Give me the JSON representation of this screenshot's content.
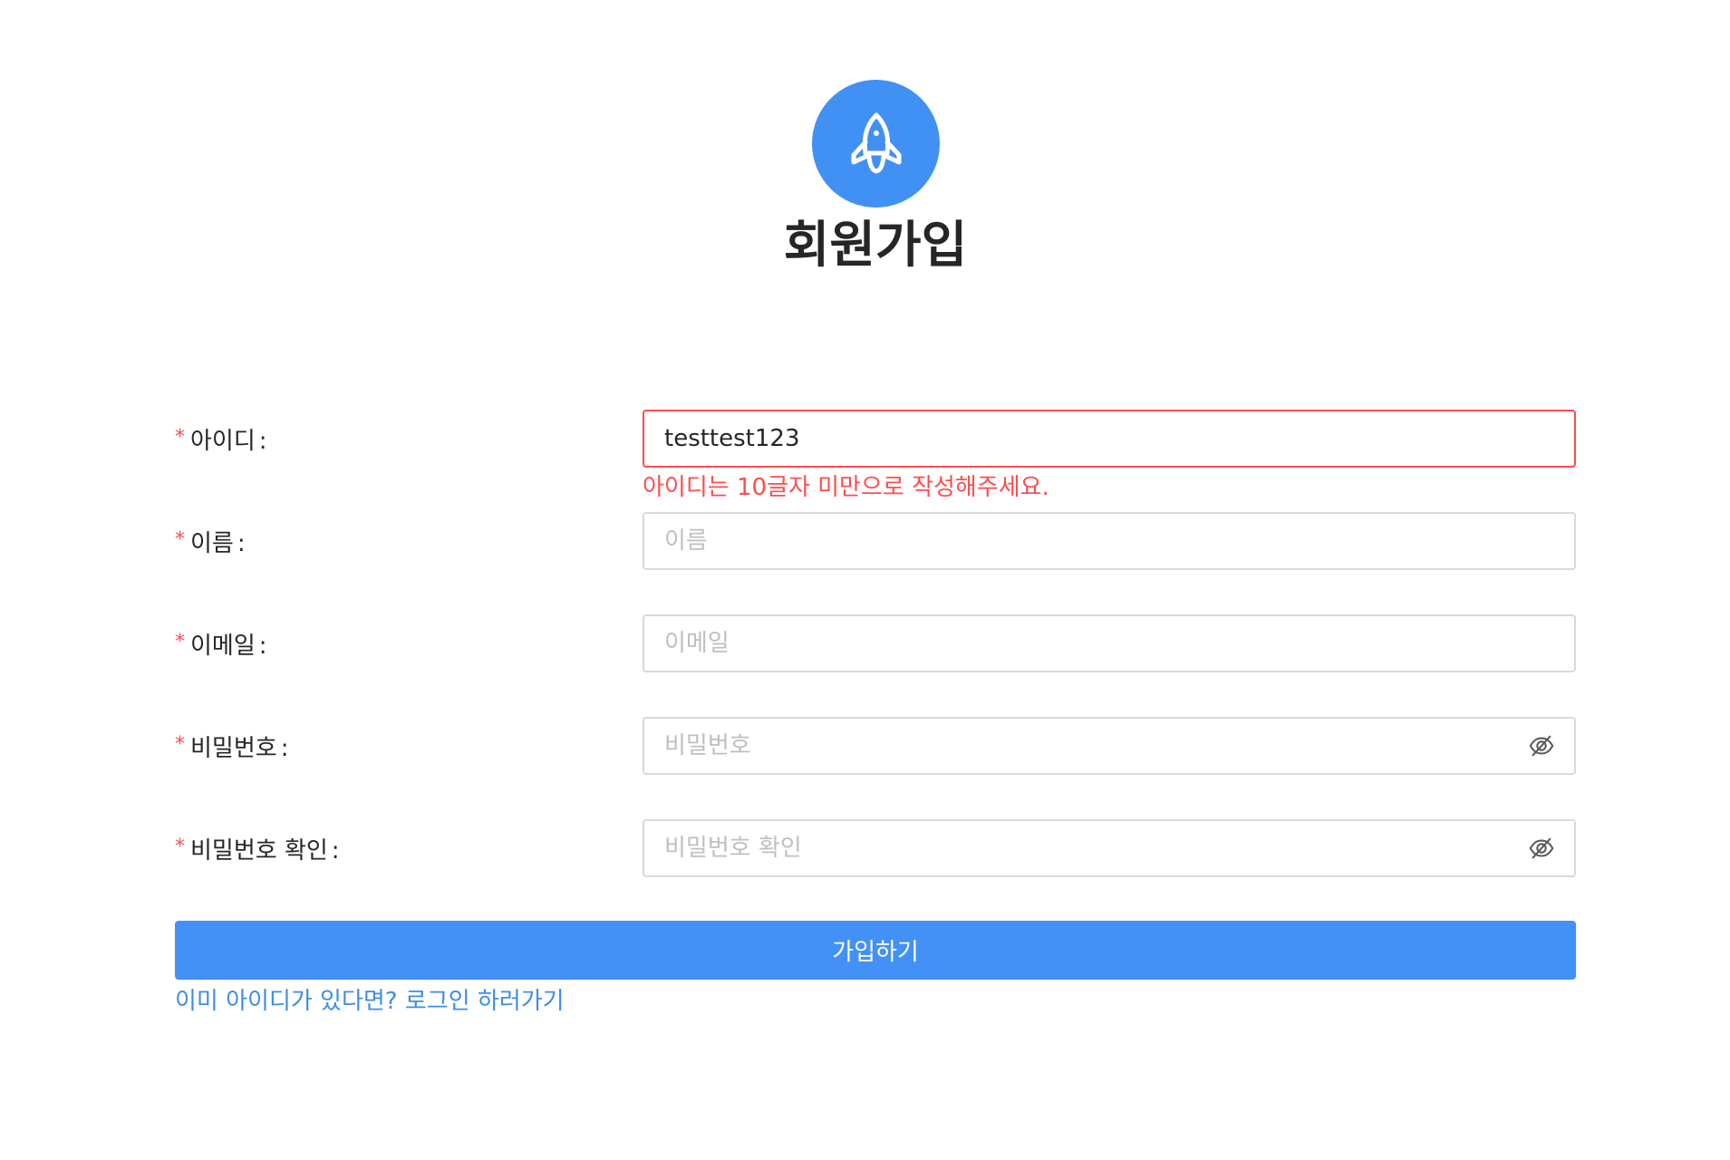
{
  "header": {
    "logo_icon": "rocket-icon",
    "title": "회원가입",
    "accent_color": "#4190f3"
  },
  "form": {
    "fields": [
      {
        "label": "아이디",
        "required_mark": "*",
        "colon": ":",
        "value": "testtest123",
        "placeholder": "",
        "error": "아이디는 10글자 미만으로 작성해주세요."
      },
      {
        "label": "이름",
        "required_mark": "*",
        "colon": ":",
        "value": "",
        "placeholder": "이름"
      },
      {
        "label": "이메일",
        "required_mark": "*",
        "colon": ":",
        "value": "",
        "placeholder": "이메일"
      },
      {
        "label": "비밀번호",
        "required_mark": "*",
        "colon": ":",
        "value": "",
        "placeholder": "비밀번호",
        "toggle_icon": "eye-invisible-icon"
      },
      {
        "label": "비밀번호 확인",
        "required_mark": "*",
        "colon": ":",
        "value": "",
        "placeholder": "비밀번호 확인",
        "toggle_icon": "eye-invisible-icon"
      }
    ],
    "submit_label": "가입하기",
    "login_link": "이미 아이디가 있다면? 로그인 하러가기",
    "colors": {
      "error": "#ff4d4f",
      "primary": "#4390f7",
      "link": "#3d8de6"
    }
  }
}
